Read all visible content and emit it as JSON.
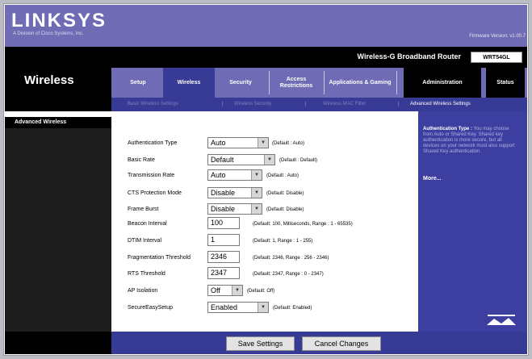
{
  "header": {
    "logo": "LINKSYS",
    "logo_sub": "A Division of Cisco Systems, Inc.",
    "firmware": "Firmware Version: v1.00.7",
    "product": "Wireless-G Broadband Router",
    "model": "WRT54GL",
    "section": "Wireless"
  },
  "tabs": [
    {
      "label": "Setup"
    },
    {
      "label": "Wireless"
    },
    {
      "label": "Security"
    },
    {
      "label": "Access Restrictions"
    },
    {
      "label": "Applications & Gaming"
    },
    {
      "label": "Administration"
    },
    {
      "label": "Status"
    }
  ],
  "subtabs": [
    {
      "label": "Basic Wireless Settings"
    },
    {
      "label": "Wireless Security"
    },
    {
      "label": "Wireless MAC Filter"
    },
    {
      "label": "Advanced Wireless Settings"
    }
  ],
  "left_label": "Advanced Wireless",
  "form": {
    "auth_type": {
      "label": "Authentication Type",
      "value": "Auto",
      "default": "(Default : Auto)"
    },
    "basic_rate": {
      "label": "Basic Rate",
      "value": "Default",
      "default": "(Default : Default)"
    },
    "tx_rate": {
      "label": "Transmission Rate",
      "value": "Auto",
      "default": "(Default : Auto)"
    },
    "cts": {
      "label": "CTS Protection Mode",
      "value": "Disable",
      "default": "(Default: Disable)"
    },
    "frame_burst": {
      "label": "Frame Burst",
      "value": "Disable",
      "default": "(Default: Disable)"
    },
    "beacon": {
      "label": "Beacon Interval",
      "value": "100",
      "default": "(Default: 100, Milliseconds, Range : 1 - 65535)"
    },
    "dtim": {
      "label": "DTIM Interval",
      "value": "1",
      "default": "(Default: 1, Range : 1 - 255)"
    },
    "frag": {
      "label": "Fragmentation Threshold",
      "value": "2346",
      "default": "(Default: 2346, Range : 256 - 2346)"
    },
    "rts": {
      "label": "RTS Threshold",
      "value": "2347",
      "default": "(Default: 2347, Range : 0 - 2347)"
    },
    "ap_iso": {
      "label": "AP Isolation",
      "value": "Off",
      "default": "(Default: Off)"
    },
    "secure_easy": {
      "label": "SecureEasySetup",
      "value": "Enabled",
      "default": "(Default: Enabled)"
    }
  },
  "help": {
    "title": "Authentication Type :",
    "body": "You may choose from Auto or Shared Key. Shared key authentication is more secure, but all devices on your network must also support Shared Key authentication.",
    "more": "More..."
  },
  "buttons": {
    "save": "Save Settings",
    "cancel": "Cancel Changes"
  },
  "colors": {
    "brand": "#6f6bb4",
    "active": "#383b96",
    "bar": "#000000"
  }
}
